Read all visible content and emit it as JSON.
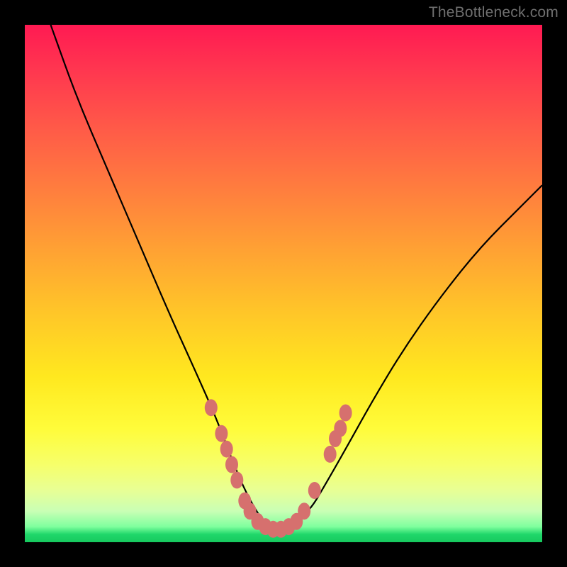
{
  "watermark": "TheBottleneck.com",
  "colors": {
    "frame": "#000000",
    "gradient_top": "#ff1a52",
    "gradient_bottom": "#17c95f",
    "curve": "#000000",
    "bead": "#d6706e"
  },
  "chart_data": {
    "type": "line",
    "title": "",
    "xlabel": "",
    "ylabel": "",
    "xlim": [
      0,
      100
    ],
    "ylim": [
      0,
      100
    ],
    "grid": false,
    "legend": false,
    "note": "Axes are unlabeled in the image; x and y are normalized 0-100. y=100 is top (most bottleneck / red), y≈0 is bottom (green). Curve is a V shape with minimum near x≈48.",
    "series": [
      {
        "name": "bottleneck-curve",
        "x": [
          5,
          10,
          16,
          22,
          28,
          33,
          37,
          40,
          43,
          46,
          48,
          51,
          55,
          58,
          62,
          67,
          73,
          80,
          88,
          96,
          100
        ],
        "y": [
          100,
          86,
          72,
          58,
          44,
          33,
          24,
          16,
          9,
          4,
          2,
          3,
          6,
          11,
          18,
          27,
          37,
          47,
          57,
          65,
          69
        ]
      }
    ],
    "markers": {
      "name": "beads",
      "note": "Pink ovals along the lower part of the curve.",
      "points": [
        {
          "x": 36,
          "y": 26
        },
        {
          "x": 38,
          "y": 21
        },
        {
          "x": 39,
          "y": 18
        },
        {
          "x": 40,
          "y": 15
        },
        {
          "x": 41,
          "y": 12
        },
        {
          "x": 42.5,
          "y": 8
        },
        {
          "x": 43.5,
          "y": 6
        },
        {
          "x": 45,
          "y": 4
        },
        {
          "x": 46.5,
          "y": 3
        },
        {
          "x": 48,
          "y": 2.5
        },
        {
          "x": 49.5,
          "y": 2.5
        },
        {
          "x": 51,
          "y": 3
        },
        {
          "x": 52.5,
          "y": 4
        },
        {
          "x": 54,
          "y": 6
        },
        {
          "x": 56,
          "y": 10
        },
        {
          "x": 59,
          "y": 17
        },
        {
          "x": 60,
          "y": 20
        },
        {
          "x": 61,
          "y": 22
        },
        {
          "x": 62,
          "y": 25
        }
      ]
    }
  }
}
